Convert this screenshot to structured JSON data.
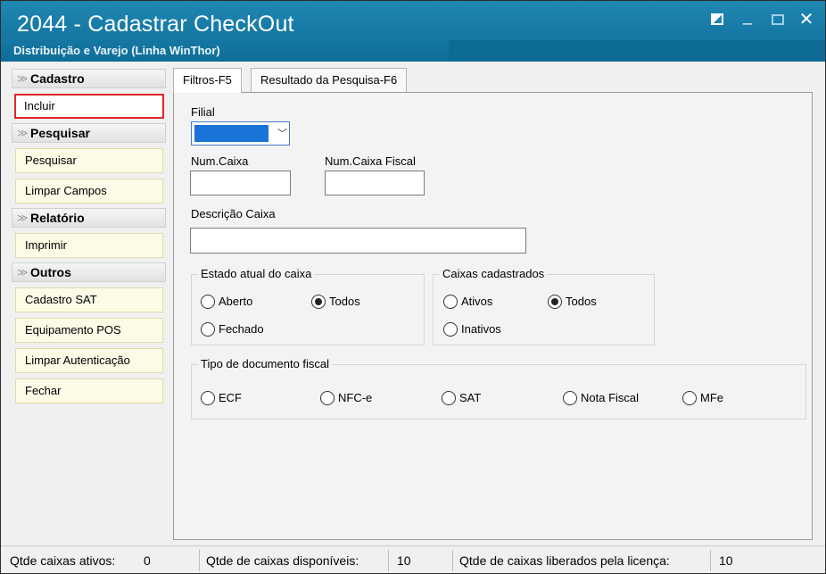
{
  "window": {
    "title": "2044 - Cadastrar CheckOut",
    "subtitle": "Distribuição e Varejo (Linha WinThor)",
    "controls": {
      "minimize": "_",
      "close": "✕"
    }
  },
  "sidebar": {
    "groups": [
      {
        "label": "Cadastro",
        "icon": "chevron-double-down-icon",
        "items": [
          {
            "label": "Incluir",
            "selected": true
          }
        ]
      },
      {
        "label": "Pesquisar",
        "icon": "chevron-double-down-icon",
        "items": [
          {
            "label": "Pesquisar"
          },
          {
            "label": "Limpar Campos"
          }
        ]
      },
      {
        "label": "Relatório",
        "icon": "chevron-double-down-icon",
        "items": [
          {
            "label": "Imprimir"
          }
        ]
      },
      {
        "label": "Outros",
        "icon": "chevron-double-down-icon",
        "items": [
          {
            "label": "Cadastro SAT"
          },
          {
            "label": "Equipamento POS"
          },
          {
            "label": "Limpar Autenticação"
          },
          {
            "label": "Fechar"
          }
        ]
      }
    ],
    "chevron_glyph": "≫"
  },
  "tabs": [
    {
      "label": "Filtros-F5",
      "active": true
    },
    {
      "label": "Resultado da Pesquisa-F6",
      "active": false
    }
  ],
  "filters": {
    "filial_label": "Filial",
    "filial_value": "",
    "combo_arrow": "﹀",
    "num_caixa_label": "Num.Caixa",
    "num_caixa_value": "",
    "num_caixa_fiscal_label": "Num.Caixa Fiscal",
    "num_caixa_fiscal_value": "",
    "descricao_label": "Descrição Caixa",
    "descricao_value": "",
    "estado": {
      "legend": "Estado atual do caixa",
      "options": [
        {
          "label": "Aberto",
          "checked": false
        },
        {
          "label": "Todos",
          "checked": true
        },
        {
          "label": "Fechado",
          "checked": false
        }
      ]
    },
    "caixas": {
      "legend": "Caixas cadastrados",
      "options": [
        {
          "label": "Ativos",
          "checked": false
        },
        {
          "label": "Todos",
          "checked": true
        },
        {
          "label": "Inativos",
          "checked": false
        }
      ]
    },
    "tipo_doc": {
      "legend": "Tipo de documento fiscal",
      "options": [
        {
          "label": "ECF",
          "checked": false
        },
        {
          "label": "NFC-e",
          "checked": false
        },
        {
          "label": "SAT",
          "checked": false
        },
        {
          "label": "Nota Fiscal",
          "checked": false
        },
        {
          "label": "MFe",
          "checked": false
        }
      ]
    }
  },
  "statusbar": {
    "ativos_label": "Qtde caixas ativos:",
    "ativos_value": "0",
    "disponiveis_label": "Qtde de caixas disponíveis:",
    "disponiveis_value": "10",
    "liberados_label": "Qtde de caixas liberados pela licença:",
    "liberados_value": "10"
  },
  "colors": {
    "titlebar": "#1479a6",
    "selected_outline": "#e0262a",
    "sidebar_button": "#fbfbe6"
  }
}
